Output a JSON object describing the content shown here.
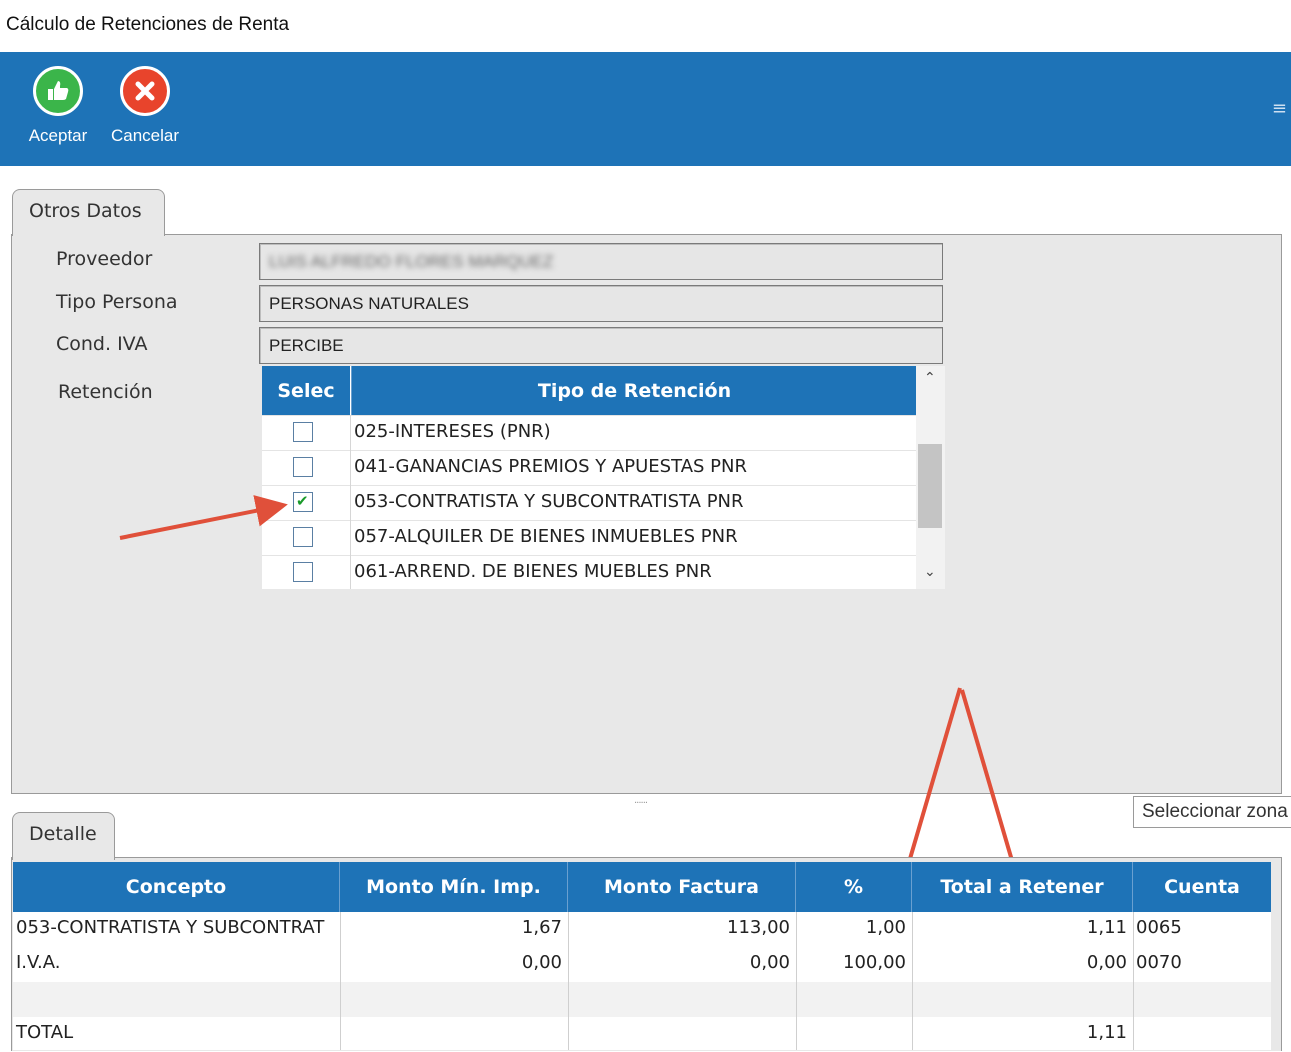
{
  "window": {
    "title": "Cálculo de Retenciones de Renta"
  },
  "toolbar": {
    "accept_label": "Aceptar",
    "cancel_label": "Cancelar",
    "color": "#1e73b7"
  },
  "otros_datos": {
    "tab_label": "Otros Datos",
    "proveedor_label": "Proveedor",
    "proveedor_value": "LUIS ALFREDO FLORES MARQUEZ",
    "tipo_persona_label": "Tipo Persona",
    "tipo_persona_value": "PERSONAS NATURALES",
    "cond_iva_label": "Cond. IVA",
    "cond_iva_value": "PERCIBE",
    "retencion_label": "Retención"
  },
  "retention_grid": {
    "headers": [
      "Selec",
      "Tipo de Retención"
    ],
    "rows": [
      {
        "checked": false,
        "label": "025-INTERESES (PNR)"
      },
      {
        "checked": false,
        "label": "041-GANANCIAS PREMIOS Y APUESTAS PNR"
      },
      {
        "checked": true,
        "label": "053-CONTRATISTA Y SUBCONTRATISTA PNR"
      },
      {
        "checked": false,
        "label": "057-ALQUILER DE BIENES INMUEBLES PNR"
      },
      {
        "checked": false,
        "label": "061-ARREND. DE BIENES MUEBLES PNR"
      }
    ]
  },
  "splitter_grip": "......",
  "tooltip": "Seleccionar zona",
  "detalle": {
    "tab_label": "Detalle",
    "headers": [
      "Concepto",
      "Monto Mín. Imp.",
      "Monto Factura",
      "%",
      "Total a Retener",
      "Cuenta"
    ],
    "rows": [
      [
        "053-CONTRATISTA Y SUBCONTRAT",
        "1,67",
        "113,00",
        "1,00",
        "1,11",
        "0065"
      ],
      [
        "I.V.A.",
        "0,00",
        "0,00",
        "100,00",
        "0,00",
        "0070"
      ],
      [
        "",
        "",
        "",
        "",
        "",
        ""
      ],
      [
        "TOTAL",
        "",
        "",
        "",
        "1,11",
        ""
      ]
    ]
  }
}
